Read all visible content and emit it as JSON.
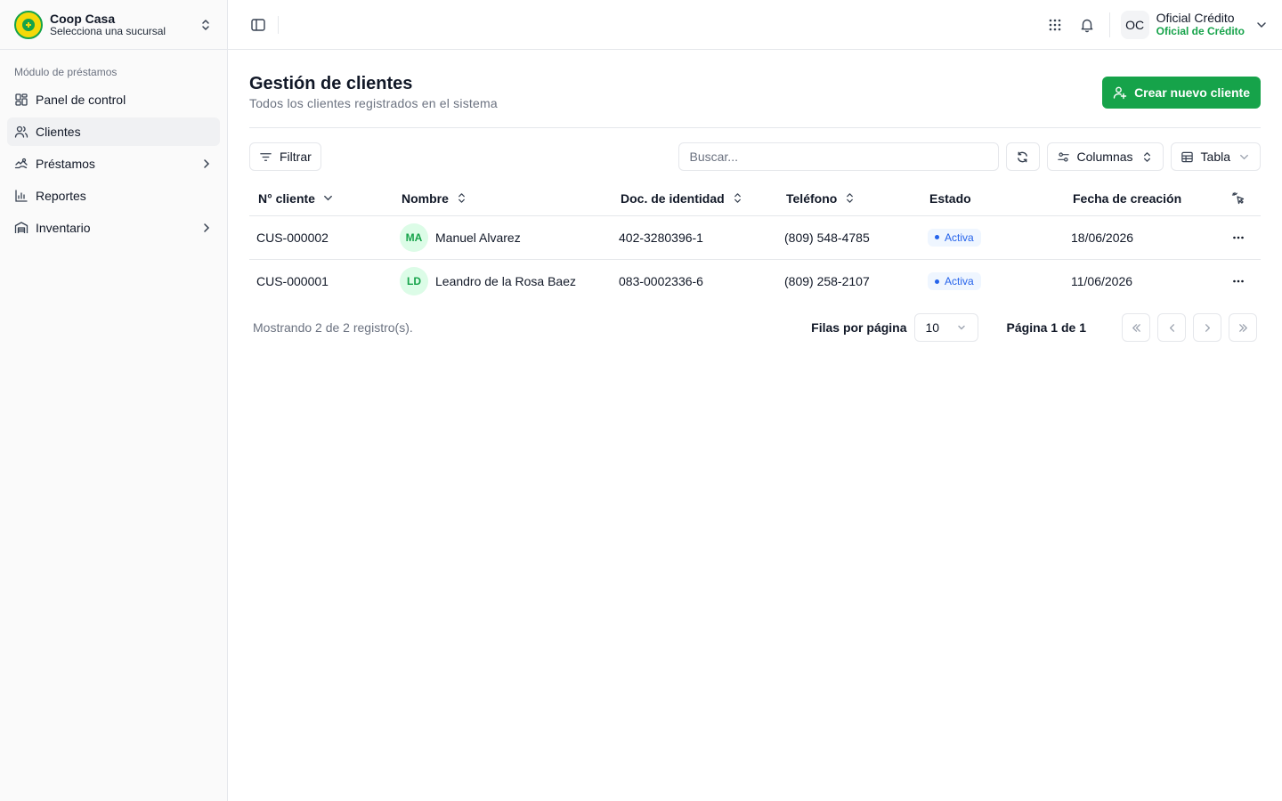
{
  "brand": {
    "name": "Coop Casa",
    "subtitle": "Selecciona una sucursal"
  },
  "sidebar": {
    "group_label": "Módulo de préstamos",
    "items": [
      {
        "label": "Panel de control",
        "icon": "dashboard-icon",
        "active": false,
        "has_submenu": false
      },
      {
        "label": "Clientes",
        "icon": "users-icon",
        "active": true,
        "has_submenu": false
      },
      {
        "label": "Préstamos",
        "icon": "loan-icon",
        "active": false,
        "has_submenu": true
      },
      {
        "label": "Reportes",
        "icon": "chart-icon",
        "active": false,
        "has_submenu": false
      },
      {
        "label": "Inventario",
        "icon": "warehouse-icon",
        "active": false,
        "has_submenu": true
      }
    ]
  },
  "header": {
    "user": {
      "initials": "OC",
      "name": "Oficial Crédito",
      "role": "Oficial de Crédito"
    }
  },
  "page": {
    "title": "Gestión de clientes",
    "subtitle": "Todos los clientes registrados en el sistema",
    "create_button": "Crear nuevo cliente"
  },
  "toolbar": {
    "filter_label": "Filtrar",
    "search_placeholder": "Buscar...",
    "columns_label": "Columnas",
    "view_label": "Tabla"
  },
  "table": {
    "columns": [
      "N° cliente",
      "Nombre",
      "Doc. de identidad",
      "Teléfono",
      "Estado",
      "Fecha de creación"
    ],
    "rows": [
      {
        "id": "CUS-000002",
        "initials": "MA",
        "name": "Manuel Alvarez",
        "doc": "402-3280396-1",
        "phone": "(809) 548-4785",
        "status": "Activa",
        "created": "18/06/2026"
      },
      {
        "id": "CUS-000001",
        "initials": "LD",
        "name": "Leandro de la Rosa Baez",
        "doc": "083-0002336-6",
        "phone": "(809) 258-2107",
        "status": "Activa",
        "created": "11/06/2026"
      }
    ]
  },
  "pagination": {
    "info": "Mostrando 2 de 2 registro(s).",
    "rows_per_page_label": "Filas por página",
    "rows_per_page": "10",
    "page_label": "Página 1 de 1"
  },
  "colors": {
    "accent": "#16a34a",
    "status_active": "#2563eb",
    "avatar_bg": "#dcfce7"
  }
}
